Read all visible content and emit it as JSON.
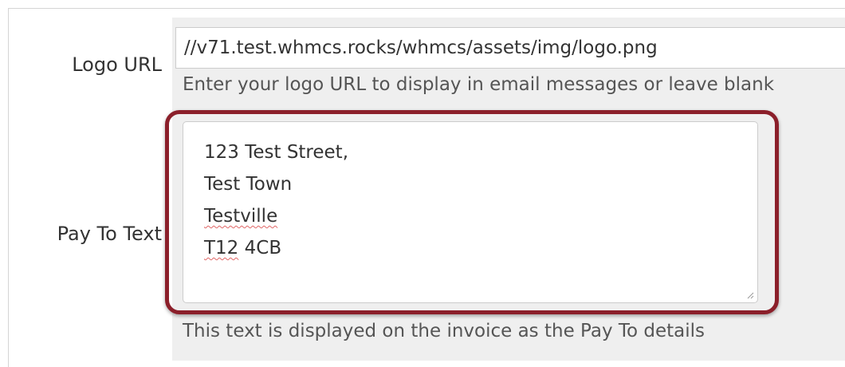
{
  "form": {
    "logo_url": {
      "label": "Logo URL",
      "value": "//v71.test.whmcs.rocks/whmcs/assets/img/logo.png",
      "help": "Enter your logo URL to display in email messages or leave blank"
    },
    "pay_to": {
      "label": "Pay To Text",
      "lines": [
        "123 Test Street,",
        "Test Town",
        "Testville",
        "T12",
        "4CB"
      ],
      "help": "This text is displayed on the invoice as the Pay To details"
    }
  },
  "colors": {
    "highlight": "#8b1f2a",
    "field_background": "#efefef"
  }
}
